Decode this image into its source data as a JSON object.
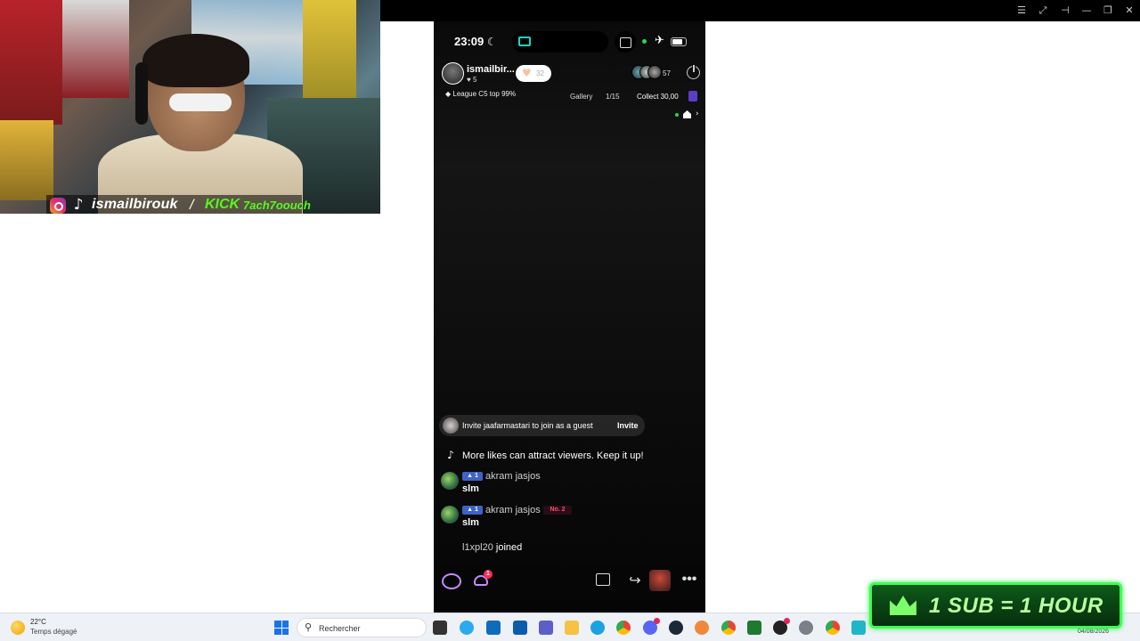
{
  "window_bar": {
    "icons": [
      "list-icon",
      "expand-icon",
      "pin-icon",
      "minimize-icon",
      "restore-icon",
      "close-icon"
    ]
  },
  "webcam": {
    "handle": "ismailbirouk",
    "separator": "/",
    "kick_label": "KICK",
    "kick_user": "7ach7oouch",
    "colors": {
      "kick": "#53fc18"
    }
  },
  "phone": {
    "status": {
      "time": "23:09",
      "moon": "☾"
    },
    "host": {
      "name": "ismailbir...",
      "likes": "♥ 5"
    },
    "like_pill": {
      "heart": "♥",
      "count": "32"
    },
    "viewer_count": "57",
    "league": "League C5 top 99%",
    "gallery": "Gallery",
    "pages": "1/15",
    "collect": "Collect 30,00",
    "invite": {
      "text": "Invite jaafarmastari to join as a guest",
      "button": "Invite"
    },
    "system_message": {
      "icon": "♪",
      "text": "More likes can attract viewers. Keep it up!"
    },
    "messages": [
      {
        "level": "1",
        "user": "akram jasjos",
        "rank": "",
        "body": "slm"
      },
      {
        "level": "1",
        "user": "akram jasjos",
        "rank": "No. 2",
        "body": "slm"
      }
    ],
    "joined": {
      "user": "l1xpl20",
      "verb": "joined"
    },
    "bottom": {
      "people_badge": "1",
      "share": "↪",
      "more": "•••"
    }
  },
  "taskbar": {
    "temperature": "22°C",
    "weather_desc": "Temps dégagé",
    "search_placeholder": "Rechercher",
    "date": "04/08/2026"
  },
  "sub_banner": {
    "text": "1 SUB = 1 HOUR"
  }
}
